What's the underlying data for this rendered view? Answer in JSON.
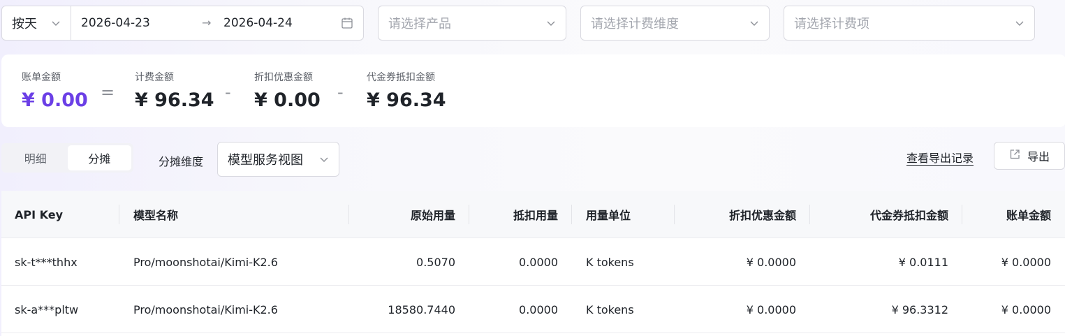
{
  "filters": {
    "date_mode": "按天",
    "date_start": "2026-04-23",
    "date_end": "2026-04-24",
    "arrow": "→",
    "product_placeholder": "请选择产品",
    "dimension_placeholder": "请选择计费维度",
    "item_placeholder": "请选择计费项"
  },
  "summary": {
    "bill_label": "账单金额",
    "bill_value": "¥ 0.00",
    "eq": "=",
    "charge_label": "计费金额",
    "charge_value": "¥ 96.34",
    "minus1": "-",
    "discount_label": "折扣优惠金额",
    "discount_value": "¥ 0.00",
    "minus2": "-",
    "voucher_label": "代金券抵扣金额",
    "voucher_value": "¥ 96.34"
  },
  "toolbar": {
    "tab_detail": "明细",
    "tab_allocation": "分摊",
    "dim_label": "分摊维度",
    "dim_value": "模型服务视图",
    "export_records": "查看导出记录",
    "export": "导出"
  },
  "table": {
    "headers": [
      "API Key",
      "模型名称",
      "原始用量",
      "抵扣用量",
      "用量单位",
      "折扣优惠金额",
      "代金券抵扣金额",
      "账单金额"
    ],
    "rows": [
      [
        "sk-t***thhx",
        "Pro/moonshotai/Kimi-K2.6",
        "0.5070",
        "0.0000",
        "K tokens",
        "¥ 0.0000",
        "¥ 0.0111",
        "¥ 0.0000"
      ],
      [
        "sk-a***pltw",
        "Pro/moonshotai/Kimi-K2.6",
        "18580.7440",
        "0.0000",
        "K tokens",
        "¥ 0.0000",
        "¥ 96.3312",
        "¥ 0.0000"
      ]
    ]
  },
  "colors": {
    "primary": "#6b3fe6",
    "border": "#d9d9e0"
  }
}
